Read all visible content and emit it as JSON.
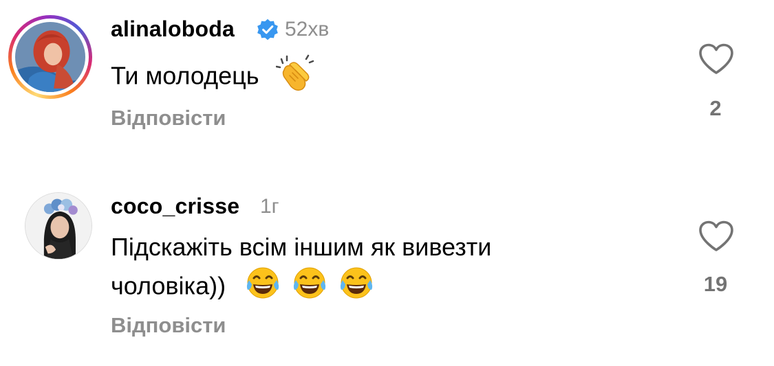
{
  "comments": [
    {
      "username": "alinaloboda",
      "verified": true,
      "time": "52хв",
      "text": "Ти молодець",
      "emojis": [
        "clapping-hands-emoji"
      ],
      "reply_label": "Відповісти",
      "likes": "2",
      "has_story_ring": true
    },
    {
      "username": "coco_crisse",
      "verified": false,
      "time": "1г",
      "text_line1": "Підскажіть всім іншим як вивезти",
      "text_line2": "чоловіка))",
      "emojis": [
        "tears-of-joy-emoji",
        "tears-of-joy-emoji",
        "tears-of-joy-emoji"
      ],
      "reply_label": "Відповісти",
      "likes": "19",
      "has_story_ring": false
    }
  ],
  "colors": {
    "secondary_text": "#8e8e8e",
    "verified_blue": "#3897f0",
    "like_icon": "#737373"
  }
}
